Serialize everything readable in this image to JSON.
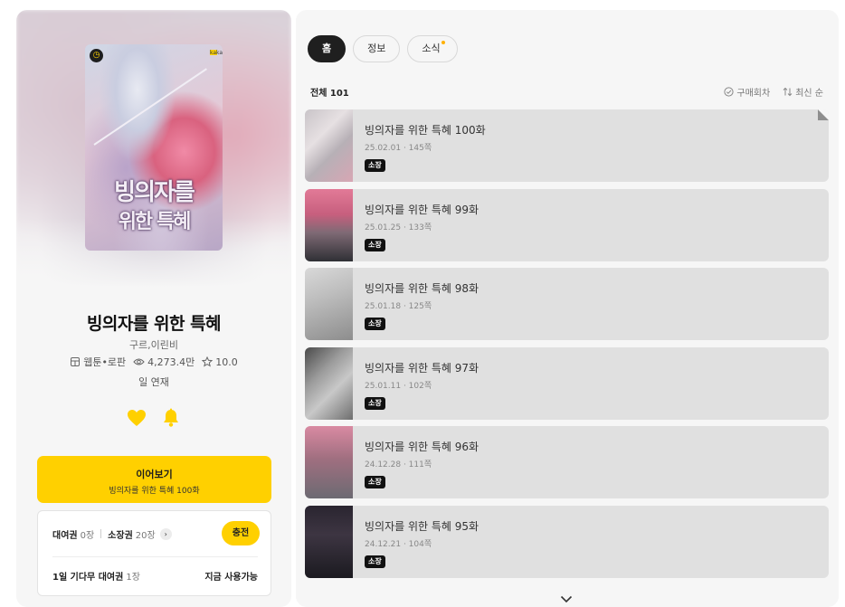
{
  "cover": {
    "title_line1": "빙의자를",
    "title_line2": "위한 특혜",
    "badge_icon": "clock-icon",
    "logo_text": "kakaopage"
  },
  "work": {
    "title": "빙의자를 위한 특혜",
    "authors": "구르,이린비",
    "genre": "웹툰•로판",
    "views": "4,273.4만",
    "rating": "10.0",
    "schedule": "일 연재"
  },
  "actions": {
    "like_icon": "heart-icon",
    "alarm_icon": "bell-icon"
  },
  "continue": {
    "label": "이어보기",
    "episode": "빙의자를 위한 특혜 100화"
  },
  "tickets": {
    "rental_label": "대여권",
    "rental_count": "0장",
    "own_label": "소장권",
    "own_count": "20장",
    "charge_label": "충전",
    "wait_label": "1일 기다무 대여권",
    "wait_count": "1장",
    "wait_status": "지금 사용가능"
  },
  "tabs": [
    {
      "label": "홈",
      "active": true
    },
    {
      "label": "정보",
      "active": false
    },
    {
      "label": "소식",
      "active": false,
      "has_new": true
    }
  ],
  "list": {
    "total": "전체 101",
    "purchased_label": "구매회차",
    "sort_label": "최신 순"
  },
  "episodes": [
    {
      "title": "빙의자를 위한 특혜 100화",
      "date": "25.02.01",
      "pages": "145쪽",
      "badge": "소장"
    },
    {
      "title": "빙의자를 위한 특혜 99화",
      "date": "25.01.25",
      "pages": "133쪽",
      "badge": "소장"
    },
    {
      "title": "빙의자를 위한 특혜 98화",
      "date": "25.01.18",
      "pages": "125쪽",
      "badge": "소장"
    },
    {
      "title": "빙의자를 위한 특혜 97화",
      "date": "25.01.11",
      "pages": "102쪽",
      "badge": "소장"
    },
    {
      "title": "빙의자를 위한 특혜 96화",
      "date": "24.12.28",
      "pages": "111쪽",
      "badge": "소장"
    },
    {
      "title": "빙의자를 위한 특혜 95화",
      "date": "24.12.21",
      "pages": "104쪽",
      "badge": "소장"
    }
  ],
  "colors": {
    "accent": "#ffd000",
    "dark": "#1f1f1f",
    "panel": "#f6f6f6"
  }
}
